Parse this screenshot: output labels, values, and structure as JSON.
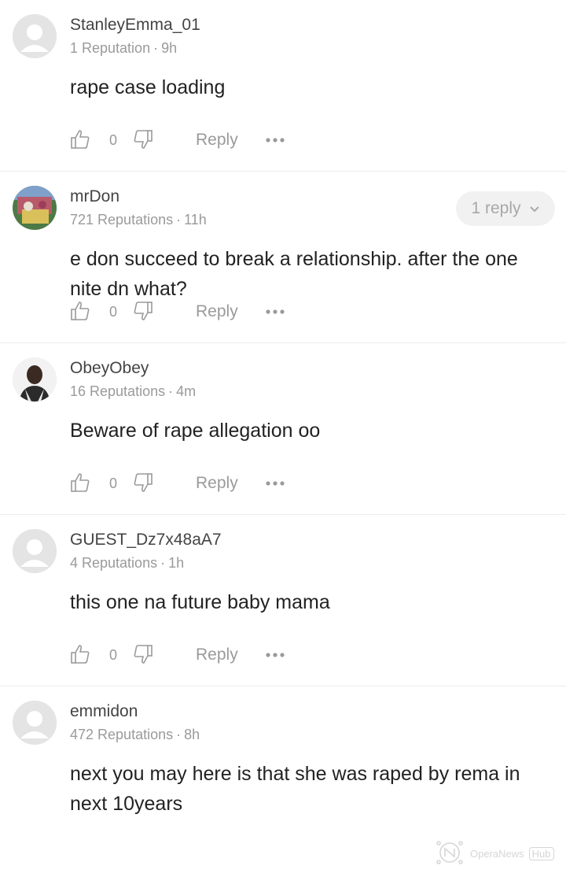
{
  "comments": [
    {
      "username": "StanleyEmma_01",
      "reputation": "1 Reputation",
      "time": "9h",
      "text": "rape case loading",
      "likes": "0",
      "reply_label": "Reply",
      "avatar_type": "default"
    },
    {
      "username": "mrDon",
      "reputation": "721 Reputations",
      "time": "11h",
      "text": "e don succeed to break a relationship. after the one nite dn what?",
      "likes": "0",
      "reply_label": "Reply",
      "replies_badge": "1 reply",
      "avatar_type": "photo"
    },
    {
      "username": "ObeyObey",
      "reputation": "16 Reputations",
      "time": "4m",
      "text": "Beware of rape allegation oo",
      "likes": "0",
      "reply_label": "Reply",
      "avatar_type": "photo"
    },
    {
      "username": "GUEST_Dz7x48aA7",
      "reputation": "4 Reputations",
      "time": "1h",
      "text": "this one na future baby mama",
      "likes": "0",
      "reply_label": "Reply",
      "avatar_type": "default"
    },
    {
      "username": "emmidon",
      "reputation": "472 Reputations",
      "time": "8h",
      "text": "next you may here is that she was raped by rema in next 10years",
      "avatar_type": "default"
    }
  ],
  "watermark": {
    "brand": "OperaNews",
    "hub": "Hub"
  },
  "separator": "·",
  "icons": {
    "like": "thumbs-up-outline-icon",
    "dislike": "thumbs-down-outline-icon",
    "more": "more-dots-icon",
    "chevron": "chevron-down-icon"
  },
  "colors": {
    "text": "#222222",
    "meta": "#9a9a9a",
    "pill_bg": "#f1f1f1",
    "divider": "#ececec"
  }
}
